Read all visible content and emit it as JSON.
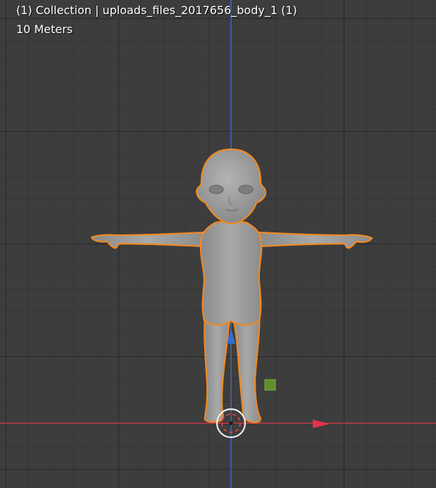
{
  "viewport": {
    "title": "(1) Collection | uploads_files_2017656_body_1 (1)",
    "scale_label": "10 Meters"
  },
  "colors": {
    "background": "#3d3d3d",
    "x_axis": "#c9374b",
    "y_axis": "#2f6fd6",
    "selection_outline": "#f08a24",
    "mesh": "#9b9b9b",
    "gizmo_cube": "#5f8f2c"
  },
  "scene": {
    "object": "character-body-mesh",
    "selected": true,
    "gizmo": "move-gizmo",
    "cursor": "3d-cursor"
  }
}
